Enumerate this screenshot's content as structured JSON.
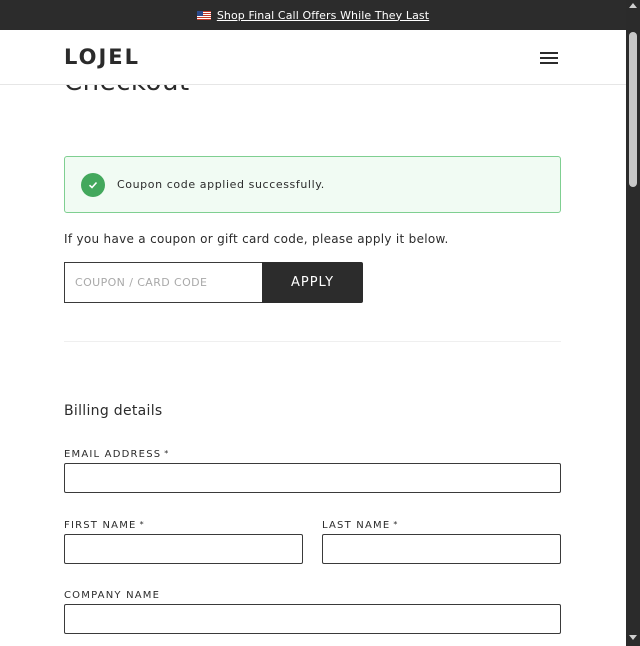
{
  "announcement": {
    "text": "Shop Final Call Offers While They Last",
    "flag_icon": "us-flag-icon"
  },
  "header": {
    "logo": "LOJEL",
    "menu_icon": "hamburger-menu-icon"
  },
  "page": {
    "title": "Checkout"
  },
  "notice": {
    "message": "Coupon code applied successfully.",
    "icon": "check-circle-icon",
    "color": "#43a85c"
  },
  "coupon": {
    "hint": "If you have a coupon or gift card code, please apply it below.",
    "placeholder": "COUPON / CARD CODE",
    "apply_label": "APPLY"
  },
  "billing": {
    "title": "Billing details",
    "required_mark": "*",
    "email_label": "EMAIL ADDRESS",
    "first_name_label": "FIRST NAME",
    "last_name_label": "LAST NAME",
    "company_label": "COMPANY NAME"
  },
  "colors": {
    "dark": "#2c2c2c",
    "success_bg": "#f1fbf3",
    "success_border": "#7fcf91"
  }
}
